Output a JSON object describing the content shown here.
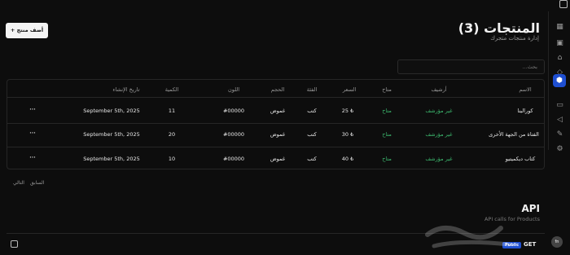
{
  "header": {
    "title": "المنتجات (3)",
    "subtitle": "إدارة منتجات متجرك",
    "add_button": "+ أضف منتج"
  },
  "search": {
    "placeholder": "بحث..."
  },
  "table": {
    "columns": {
      "name": "الاسم",
      "archive": "أرشيف",
      "available": "متاح",
      "price": "السعر",
      "category": "الفئة",
      "size": "الحجم",
      "color": "اللون",
      "quantity": "الكمية",
      "created": "تاريخ الإنشاء"
    },
    "rows": [
      {
        "name": "كورالينا",
        "archive": "غير مؤرشف",
        "available": "متاح",
        "price": "25",
        "currency": "₺",
        "category": "كتب",
        "size": "غموض",
        "color": "#00000",
        "quantity": "11",
        "created": "September 5th, 2025",
        "menu": "···"
      },
      {
        "name": "الفتاة من الجهة الأخرى",
        "archive": "غير مؤرشف",
        "available": "متاح",
        "price": "30",
        "currency": "₺",
        "category": "كتب",
        "size": "غموض",
        "color": "#00000",
        "quantity": "20",
        "created": "September 5th, 2025",
        "menu": "···"
      },
      {
        "name": "كتاب ديكميتيو",
        "archive": "غير مؤرشف",
        "available": "متاح",
        "price": "40",
        "currency": "₺",
        "category": "كتب",
        "size": "غموض",
        "color": "#00000",
        "quantity": "10",
        "created": "September 5th, 2025",
        "menu": "···"
      }
    ]
  },
  "pagination": {
    "previous": "السابق",
    "next": "التالي"
  },
  "api": {
    "title": "API",
    "subtitle": "API calls for Products",
    "method": "GET",
    "badge": "Public"
  },
  "avatar": {
    "initials": "fn"
  },
  "watermark": {
    "text": "حراج"
  },
  "colors": {
    "accent": "#1f4fd1",
    "green": "#3dba6f",
    "background": "#0d0d0d"
  },
  "rail_icons": [
    "grid-icon",
    "layout-icon",
    "tag-icon",
    "ticket-icon",
    "package-icon",
    "ruler-icon",
    "megaphone-icon",
    "edit-icon",
    "settings-icon"
  ]
}
